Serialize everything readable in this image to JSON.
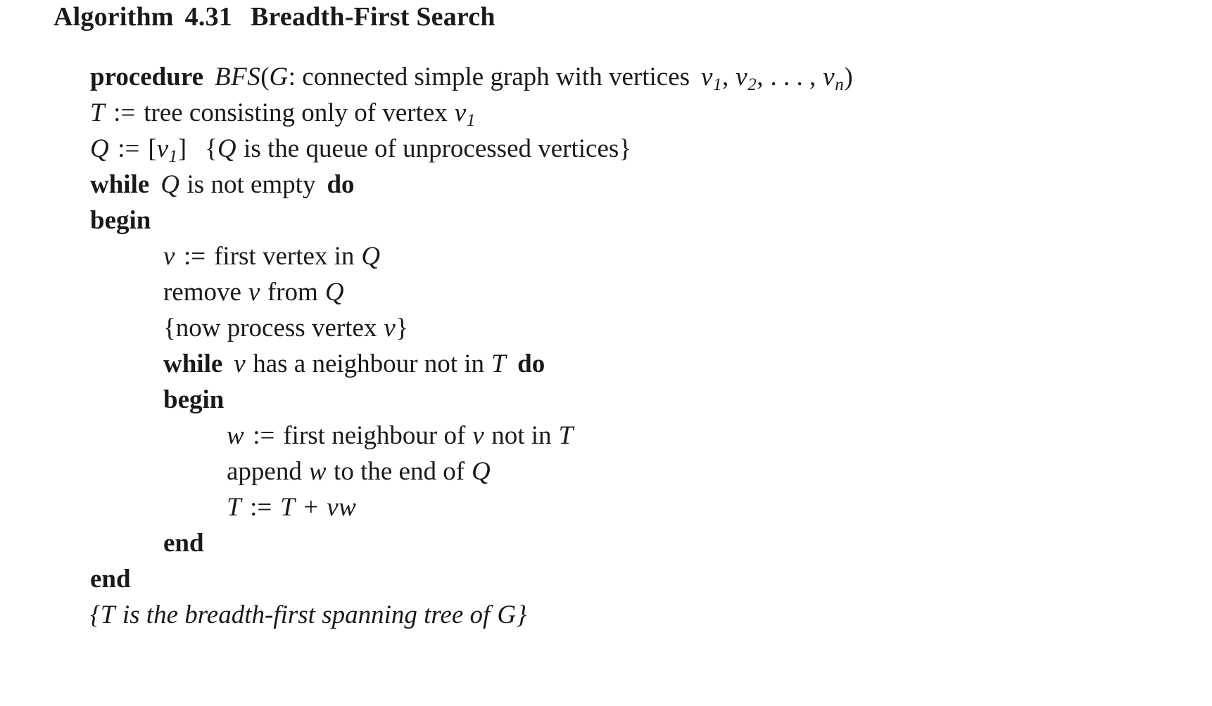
{
  "document": {
    "kind": "algorithm-pseudocode-block",
    "background_color": "#ffffff",
    "text_color": "#1a1a1a"
  },
  "title": {
    "label": "Algorithm",
    "number": "4.31",
    "name": "Breadth-First Search",
    "full": "Algorithm 4.31 Breadth-First Search"
  },
  "pseudocode": {
    "lines": [
      {
        "indent": 0,
        "plain": "procedure BFS(G: connected simple graph with vertices v1, v2, ..., vn)",
        "tokens": [
          {
            "t": "procedure",
            "style": "keyword"
          },
          {
            "t": "BFS",
            "style": "math"
          },
          {
            "t": "(",
            "style": "roman"
          },
          {
            "t": "G",
            "style": "math"
          },
          {
            "t": ": connected simple graph with vertices ",
            "style": "roman"
          },
          {
            "t": "v",
            "style": "math",
            "sub": "1"
          },
          {
            "t": ", ",
            "style": "roman"
          },
          {
            "t": "v",
            "style": "math",
            "sub": "2"
          },
          {
            "t": ", . . . , ",
            "style": "roman"
          },
          {
            "t": "v",
            "style": "math",
            "sub": "n"
          },
          {
            "t": ")",
            "style": "roman"
          }
        ]
      },
      {
        "indent": 0,
        "plain": "T := tree consisting only of vertex v1"
      },
      {
        "indent": 0,
        "plain": "Q := [v1]  {Q is the queue of unprocessed vertices}"
      },
      {
        "indent": 0,
        "plain": "while Q is not empty do"
      },
      {
        "indent": 0,
        "plain": "begin"
      },
      {
        "indent": 1,
        "plain": "v := first vertex in Q"
      },
      {
        "indent": 1,
        "plain": "remove v from Q"
      },
      {
        "indent": 1,
        "plain": "{now process vertex v}"
      },
      {
        "indent": 1,
        "plain": "while v has a neighbour not in T do"
      },
      {
        "indent": 1,
        "plain": "begin"
      },
      {
        "indent": 2,
        "plain": "w := first neighbour of v not in T"
      },
      {
        "indent": 2,
        "plain": "append w to the end of Q"
      },
      {
        "indent": 2,
        "plain": "T := T + vw"
      },
      {
        "indent": 1,
        "plain": "end"
      },
      {
        "indent": 0,
        "plain": "end"
      },
      {
        "indent": 0,
        "plain": "{T is the breadth-first spanning tree of G}"
      }
    ],
    "keywords": [
      "procedure",
      "while",
      "do",
      "begin",
      "end"
    ],
    "variables": [
      "BFS",
      "G",
      "T",
      "Q",
      "v",
      "w",
      "v1",
      "v2",
      "vn",
      "vw"
    ],
    "text": {
      "assign": ":=",
      "plus": "+",
      "colon": ":",
      "brace_open": "{",
      "brace_close": "}",
      "bracket_open": "[",
      "bracket_close": "]",
      "paren_open": "(",
      "paren_close": ")",
      "ellipsis": ". . . ,",
      "comma": ",",
      "l1_connected": ": connected simple graph with vertices",
      "l2_tree": "tree consisting only of vertex",
      "l3_queue": "is the queue of unprocessed vertices",
      "l4_notempty": "is not empty",
      "l6_firstvertex": "first vertex in",
      "l7_remove": "remove",
      "l7_from": "from",
      "l8_nowprocess": "now process vertex",
      "l9_hasneighbour": "has a neighbour not in",
      "l11_firstneighbour": "first neighbour of",
      "l11_notin": "not in",
      "l12_append": "append",
      "l12_toendof": "to the end of",
      "l16_comment": "is the breadth-first spanning tree of"
    }
  }
}
